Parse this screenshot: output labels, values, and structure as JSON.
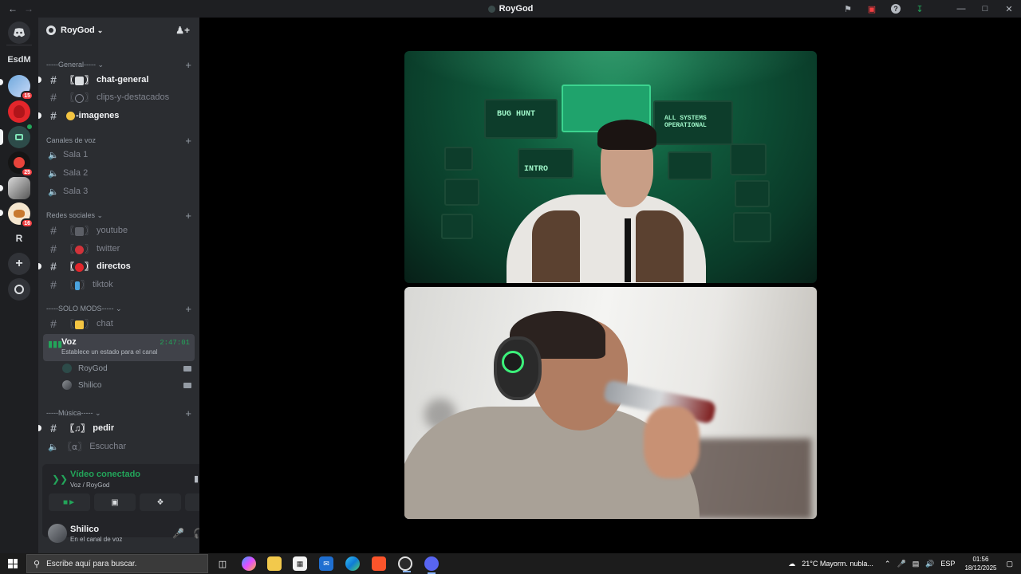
{
  "window": {
    "title": "RoyGod"
  },
  "server": {
    "name": "RoyGod"
  },
  "rail": {
    "esdm_label": "EsdM",
    "r_label": "R",
    "badges": [
      "15",
      "25",
      "16"
    ]
  },
  "categories": {
    "general": "-----General-----",
    "voice": "Canales de voz",
    "social": "Redes sociales",
    "mods": "-----SOLO MODS-----",
    "music": "-----Música-----"
  },
  "channels": {
    "chat_general": "chat-general",
    "clips": "clips-y-destacados",
    "imagenes": "-imagenes",
    "sala1": "Sala 1",
    "sala2": "Sala 2",
    "sala3": "Sala 3",
    "youtube": "youtube",
    "twitter": "twitter",
    "directos": "directos",
    "tiktok": "tiktok",
    "chat": "chat",
    "pedir": "pedir",
    "escuchar": "Escuchar"
  },
  "voice_channel": {
    "name": "Voz",
    "status": "Establece un estado para el canal",
    "timer": "2:47:01",
    "users": [
      "RoyGod",
      "Shilico"
    ]
  },
  "voice_panel": {
    "status": "Vídeo conectado",
    "location": "Voz / RoyGod"
  },
  "user": {
    "name": "Shilico",
    "status": "En el canal de voz"
  },
  "taskbar": {
    "search_placeholder": "Escribe aquí para buscar.",
    "weather": "21°C  Mayorm. nubla...",
    "lang": "ESP",
    "time": "01:56",
    "date": "18/12/2025"
  },
  "stream": {
    "monitor_1": "BUG HUNT",
    "monitor_2": "ALL SYSTEMS OPERATIONAL",
    "monitor_3": "INTRO"
  },
  "colors": {
    "accent_green": "#23a55a",
    "danger": "#f23f42",
    "sidebar_bg": "#2b2d31",
    "rail_bg": "#1e1f22"
  }
}
